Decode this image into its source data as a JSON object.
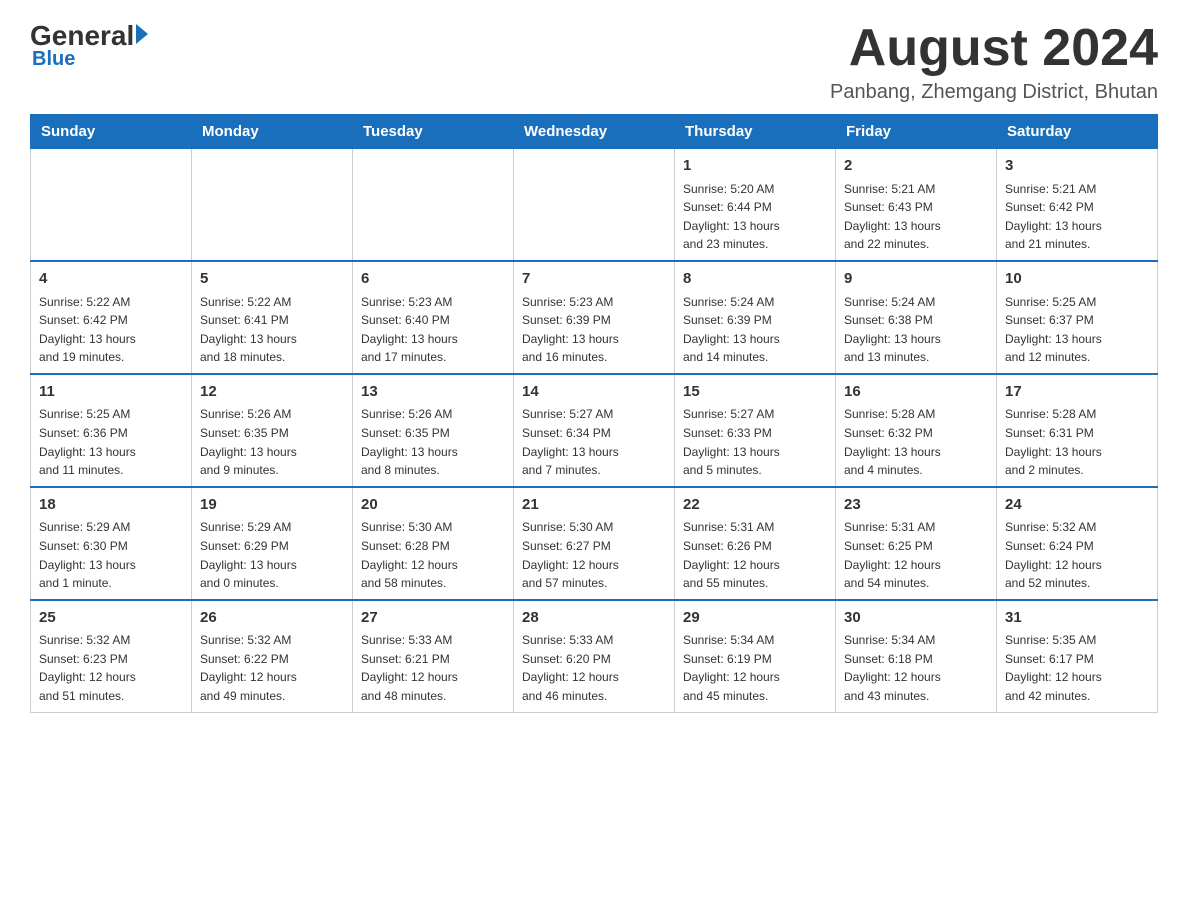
{
  "header": {
    "logo_general": "General",
    "logo_blue": "Blue",
    "title": "August 2024",
    "subtitle": "Panbang, Zhemgang District, Bhutan"
  },
  "days_of_week": [
    "Sunday",
    "Monday",
    "Tuesday",
    "Wednesday",
    "Thursday",
    "Friday",
    "Saturday"
  ],
  "weeks": [
    [
      {
        "day": "",
        "info": ""
      },
      {
        "day": "",
        "info": ""
      },
      {
        "day": "",
        "info": ""
      },
      {
        "day": "",
        "info": ""
      },
      {
        "day": "1",
        "info": "Sunrise: 5:20 AM\nSunset: 6:44 PM\nDaylight: 13 hours\nand 23 minutes."
      },
      {
        "day": "2",
        "info": "Sunrise: 5:21 AM\nSunset: 6:43 PM\nDaylight: 13 hours\nand 22 minutes."
      },
      {
        "day": "3",
        "info": "Sunrise: 5:21 AM\nSunset: 6:42 PM\nDaylight: 13 hours\nand 21 minutes."
      }
    ],
    [
      {
        "day": "4",
        "info": "Sunrise: 5:22 AM\nSunset: 6:42 PM\nDaylight: 13 hours\nand 19 minutes."
      },
      {
        "day": "5",
        "info": "Sunrise: 5:22 AM\nSunset: 6:41 PM\nDaylight: 13 hours\nand 18 minutes."
      },
      {
        "day": "6",
        "info": "Sunrise: 5:23 AM\nSunset: 6:40 PM\nDaylight: 13 hours\nand 17 minutes."
      },
      {
        "day": "7",
        "info": "Sunrise: 5:23 AM\nSunset: 6:39 PM\nDaylight: 13 hours\nand 16 minutes."
      },
      {
        "day": "8",
        "info": "Sunrise: 5:24 AM\nSunset: 6:39 PM\nDaylight: 13 hours\nand 14 minutes."
      },
      {
        "day": "9",
        "info": "Sunrise: 5:24 AM\nSunset: 6:38 PM\nDaylight: 13 hours\nand 13 minutes."
      },
      {
        "day": "10",
        "info": "Sunrise: 5:25 AM\nSunset: 6:37 PM\nDaylight: 13 hours\nand 12 minutes."
      }
    ],
    [
      {
        "day": "11",
        "info": "Sunrise: 5:25 AM\nSunset: 6:36 PM\nDaylight: 13 hours\nand 11 minutes."
      },
      {
        "day": "12",
        "info": "Sunrise: 5:26 AM\nSunset: 6:35 PM\nDaylight: 13 hours\nand 9 minutes."
      },
      {
        "day": "13",
        "info": "Sunrise: 5:26 AM\nSunset: 6:35 PM\nDaylight: 13 hours\nand 8 minutes."
      },
      {
        "day": "14",
        "info": "Sunrise: 5:27 AM\nSunset: 6:34 PM\nDaylight: 13 hours\nand 7 minutes."
      },
      {
        "day": "15",
        "info": "Sunrise: 5:27 AM\nSunset: 6:33 PM\nDaylight: 13 hours\nand 5 minutes."
      },
      {
        "day": "16",
        "info": "Sunrise: 5:28 AM\nSunset: 6:32 PM\nDaylight: 13 hours\nand 4 minutes."
      },
      {
        "day": "17",
        "info": "Sunrise: 5:28 AM\nSunset: 6:31 PM\nDaylight: 13 hours\nand 2 minutes."
      }
    ],
    [
      {
        "day": "18",
        "info": "Sunrise: 5:29 AM\nSunset: 6:30 PM\nDaylight: 13 hours\nand 1 minute."
      },
      {
        "day": "19",
        "info": "Sunrise: 5:29 AM\nSunset: 6:29 PM\nDaylight: 13 hours\nand 0 minutes."
      },
      {
        "day": "20",
        "info": "Sunrise: 5:30 AM\nSunset: 6:28 PM\nDaylight: 12 hours\nand 58 minutes."
      },
      {
        "day": "21",
        "info": "Sunrise: 5:30 AM\nSunset: 6:27 PM\nDaylight: 12 hours\nand 57 minutes."
      },
      {
        "day": "22",
        "info": "Sunrise: 5:31 AM\nSunset: 6:26 PM\nDaylight: 12 hours\nand 55 minutes."
      },
      {
        "day": "23",
        "info": "Sunrise: 5:31 AM\nSunset: 6:25 PM\nDaylight: 12 hours\nand 54 minutes."
      },
      {
        "day": "24",
        "info": "Sunrise: 5:32 AM\nSunset: 6:24 PM\nDaylight: 12 hours\nand 52 minutes."
      }
    ],
    [
      {
        "day": "25",
        "info": "Sunrise: 5:32 AM\nSunset: 6:23 PM\nDaylight: 12 hours\nand 51 minutes."
      },
      {
        "day": "26",
        "info": "Sunrise: 5:32 AM\nSunset: 6:22 PM\nDaylight: 12 hours\nand 49 minutes."
      },
      {
        "day": "27",
        "info": "Sunrise: 5:33 AM\nSunset: 6:21 PM\nDaylight: 12 hours\nand 48 minutes."
      },
      {
        "day": "28",
        "info": "Sunrise: 5:33 AM\nSunset: 6:20 PM\nDaylight: 12 hours\nand 46 minutes."
      },
      {
        "day": "29",
        "info": "Sunrise: 5:34 AM\nSunset: 6:19 PM\nDaylight: 12 hours\nand 45 minutes."
      },
      {
        "day": "30",
        "info": "Sunrise: 5:34 AM\nSunset: 6:18 PM\nDaylight: 12 hours\nand 43 minutes."
      },
      {
        "day": "31",
        "info": "Sunrise: 5:35 AM\nSunset: 6:17 PM\nDaylight: 12 hours\nand 42 minutes."
      }
    ]
  ]
}
